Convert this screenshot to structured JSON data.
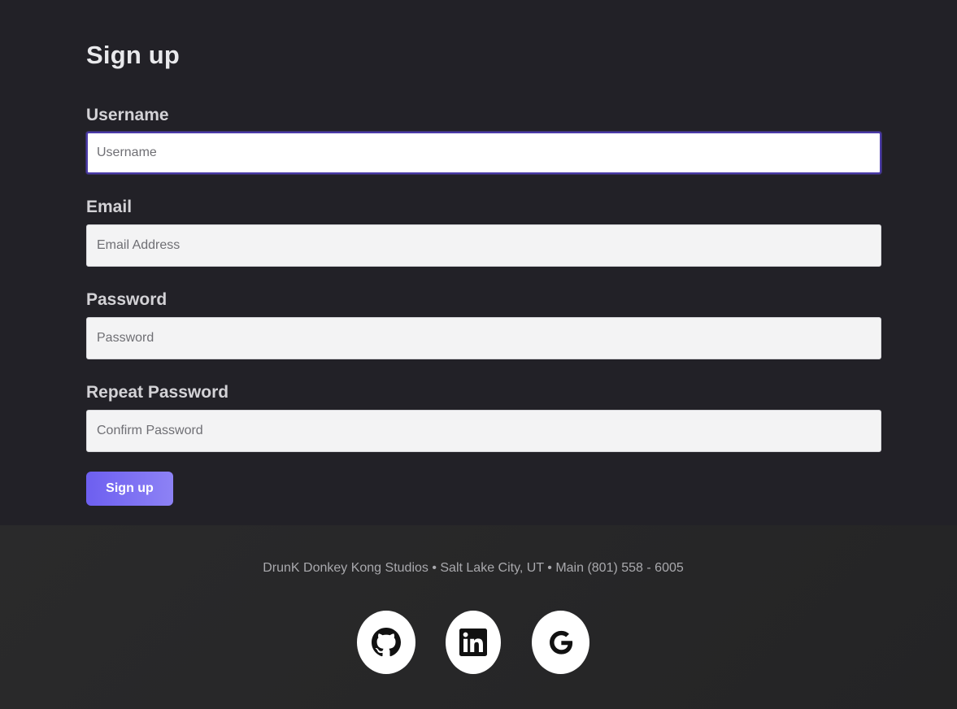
{
  "form": {
    "title": "Sign up",
    "fields": [
      {
        "label": "Username",
        "placeholder": "Username",
        "value": ""
      },
      {
        "label": "Email",
        "placeholder": "Email Address",
        "value": ""
      },
      {
        "label": "Password",
        "placeholder": "Password",
        "value": ""
      },
      {
        "label": "Repeat Password",
        "placeholder": "Confirm Password",
        "value": ""
      }
    ],
    "submit_label": "Sign up"
  },
  "footer": {
    "text": "DrunK Donkey Kong Studios • Salt Lake City, UT • Main (801) 558 - 6005",
    "social_links": [
      {
        "icon": "github-icon"
      },
      {
        "icon": "linkedin-icon"
      },
      {
        "icon": "google-icon"
      }
    ]
  },
  "colors": {
    "background": "#222127",
    "footer_background": "#2a2a2b",
    "accent": "#6d5ff0",
    "focus_border": "#4a3aa8"
  }
}
